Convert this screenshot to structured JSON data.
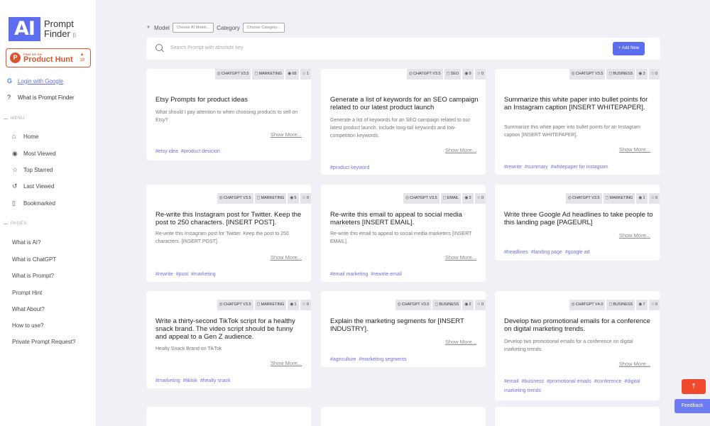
{
  "app": {
    "logo_mark": "AI",
    "logo_line1": "Prompt",
    "logo_line2": "Finder",
    "beta": "β"
  },
  "product_hunt": {
    "small": "FIND US ON",
    "big": "Product Hunt",
    "arrow": "▲",
    "count": "19"
  },
  "sidebar": {
    "login": "Login with Google",
    "what_is": "What is Prompt Finder",
    "menu_label": "MENU",
    "menu": [
      {
        "label": "Home",
        "icon": "home-icon"
      },
      {
        "label": "Most Viewed",
        "icon": "eye-icon"
      },
      {
        "label": "Top Starred",
        "icon": "star-icon"
      },
      {
        "label": "Last Viewed",
        "icon": "history-icon"
      },
      {
        "label": "Bookmarked",
        "icon": "bookmark-icon"
      }
    ],
    "pages_label": "PAGES",
    "pages": [
      "What is AI?",
      "What is ChatGPT",
      "What is Prompt?",
      "Prompt Hint",
      "What About?",
      "How to use?",
      "Private Prompt Request?"
    ]
  },
  "filters": {
    "model_label": "Model",
    "model_placeholder": "Choose AI Model...",
    "category_label": "Category",
    "category_placeholder": "Choose Category..."
  },
  "search": {
    "placeholder": "Search Prompt with absolute key",
    "add_label": "+ Add New"
  },
  "cards": [
    {
      "model": "CHATGPT V3.5",
      "category": "MARKETING",
      "views": "68",
      "stars": "1",
      "title": "Etsy Prompts for product ideas",
      "desc": "What should I pay attention to when choosing products to sell on Etsy?",
      "show_more": "Show More...",
      "keywords": [
        "#etsy idea",
        "#product desicion"
      ]
    },
    {
      "model": "CHATGPT V3.5",
      "category": "SEO",
      "views": "9",
      "stars": "0",
      "title": "Generate a list of keywords for an SEO campaign related to our latest product launch",
      "desc": "Generate a list of keywords for an SEO campaign related to our latest product launch. Include long-tail keywords and low-competition keywords.",
      "show_more": "Show More...",
      "keywords": [
        "#product keyword"
      ]
    },
    {
      "model": "CHATGPT V3.5",
      "category": "BUSINESS",
      "views": "3",
      "stars": "0",
      "title": "Summarize this white paper into bullet points for an Instagram caption [INSERT WHITEPAPER].",
      "desc": "Summarize this white paper into bullet points for an Instagram caption [INSERT WHITEPAPER].",
      "show_more": "Show More...",
      "keywords": [
        "#rewrite",
        "#summary",
        "#whitepaper for instagram"
      ]
    },
    {
      "model": "CHATGPT V3.5",
      "category": "MARKETING",
      "views": "5",
      "stars": "0",
      "title": "Re-write this Instagram post for Twitter. Keep the post to 250 characters. [INSERT POST].",
      "desc": "Re-write this Instagram post for Twitter. Keep the post to 250 characters. [INSERT POST].",
      "show_more": "Show More...",
      "keywords": [
        "#rewrite",
        "#post",
        "#marketing"
      ]
    },
    {
      "model": "CHATGPT V3.5",
      "category": "EMAIL",
      "views": "3",
      "stars": "0",
      "title": "Re-write this email to appeal to social media marketers [INSERT EMAIL].",
      "desc": "Re-write this email to appeal to social media marketers [INSERT EMAIL].",
      "show_more": "Show More...",
      "keywords": [
        "#email marketing",
        "#rewrite email"
      ]
    },
    {
      "model": "CHATGPT V3.5",
      "category": "MARKETING",
      "views": "1",
      "stars": "0",
      "title": "Write three Google Ad headlines to take people to this landing page [PAGEURL]",
      "desc": "",
      "show_more": "Show More...",
      "keywords": [
        "#headlines",
        "#landing page",
        "#google ad"
      ]
    },
    {
      "model": "CHATGPT V3.5",
      "category": "MARKETING",
      "views": "1",
      "stars": "0",
      "title": "Write a thirty-second TikTok script for a healthy snack brand. The video script should be funny and appeal to a Gen Z audience.",
      "desc": "Healty Snack Brand on TikTok",
      "show_more": "Show More...",
      "keywords": [
        "#marketing",
        "#tiktok",
        "#healty snack"
      ]
    },
    {
      "model": "CHATGPT V3.5",
      "category": "BUSINESS",
      "views": "2",
      "stars": "0",
      "title": "Explain the marketing segments for [INSERT INDUSTRY].",
      "desc": "",
      "show_more": "Show More...",
      "keywords": [
        "#agriculture",
        "#marketing segments"
      ]
    },
    {
      "model": "CHATGPT V4.0",
      "category": "BUSINESS",
      "views": "7",
      "stars": "0",
      "title": "Develop two promotional emails for a conference on digital marketing trends.",
      "desc": "Develop two promotional emails for a conference on digital marketing trends.",
      "show_more": "Show More...",
      "keywords": [
        "#email",
        "#business",
        "#promotional emails",
        "#conference",
        "#digital marketing trends"
      ]
    }
  ],
  "floating": {
    "scroll_top": "⤒",
    "feedback": "Feedback"
  }
}
